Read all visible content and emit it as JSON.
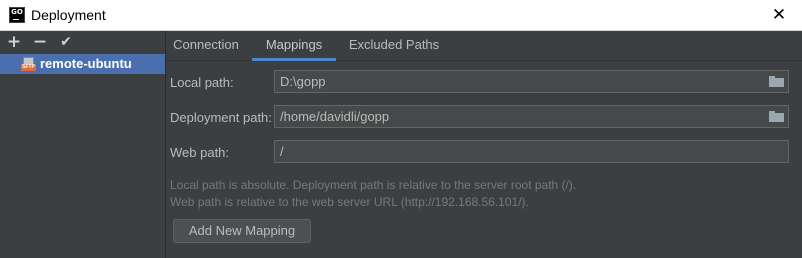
{
  "window": {
    "title": "Deployment",
    "icon_text": "GO",
    "close_glyph": "✕"
  },
  "left_toolbar": {
    "add": "+",
    "remove": "−",
    "apply": "✔"
  },
  "servers": [
    {
      "label": "remote-ubuntu",
      "icon": "sftp-icon",
      "icon_text": "SFTP",
      "selected": true
    }
  ],
  "tabs": [
    {
      "label": "Connection",
      "active": false
    },
    {
      "label": "Mappings",
      "active": true
    },
    {
      "label": "Excluded Paths",
      "active": false
    }
  ],
  "mappings": {
    "local_path": {
      "label": "Local path:",
      "value": "D:\\gopp"
    },
    "deployment_path": {
      "label": "Deployment path:",
      "value": "/home/davidli/gopp"
    },
    "web_path": {
      "label": "Web path:",
      "value": "/"
    },
    "hint_line1": "Local path is absolute. Deployment path is relative to the server root path (/).",
    "hint_line2": "Web path is relative to the web server URL (http://192.168.56.101/).",
    "add_button": "Add New Mapping"
  },
  "colors": {
    "background": "#3c3f41",
    "selection": "#4b6eaf",
    "active_tab_underline": "#4a88c7",
    "field_background": "#45494a"
  }
}
